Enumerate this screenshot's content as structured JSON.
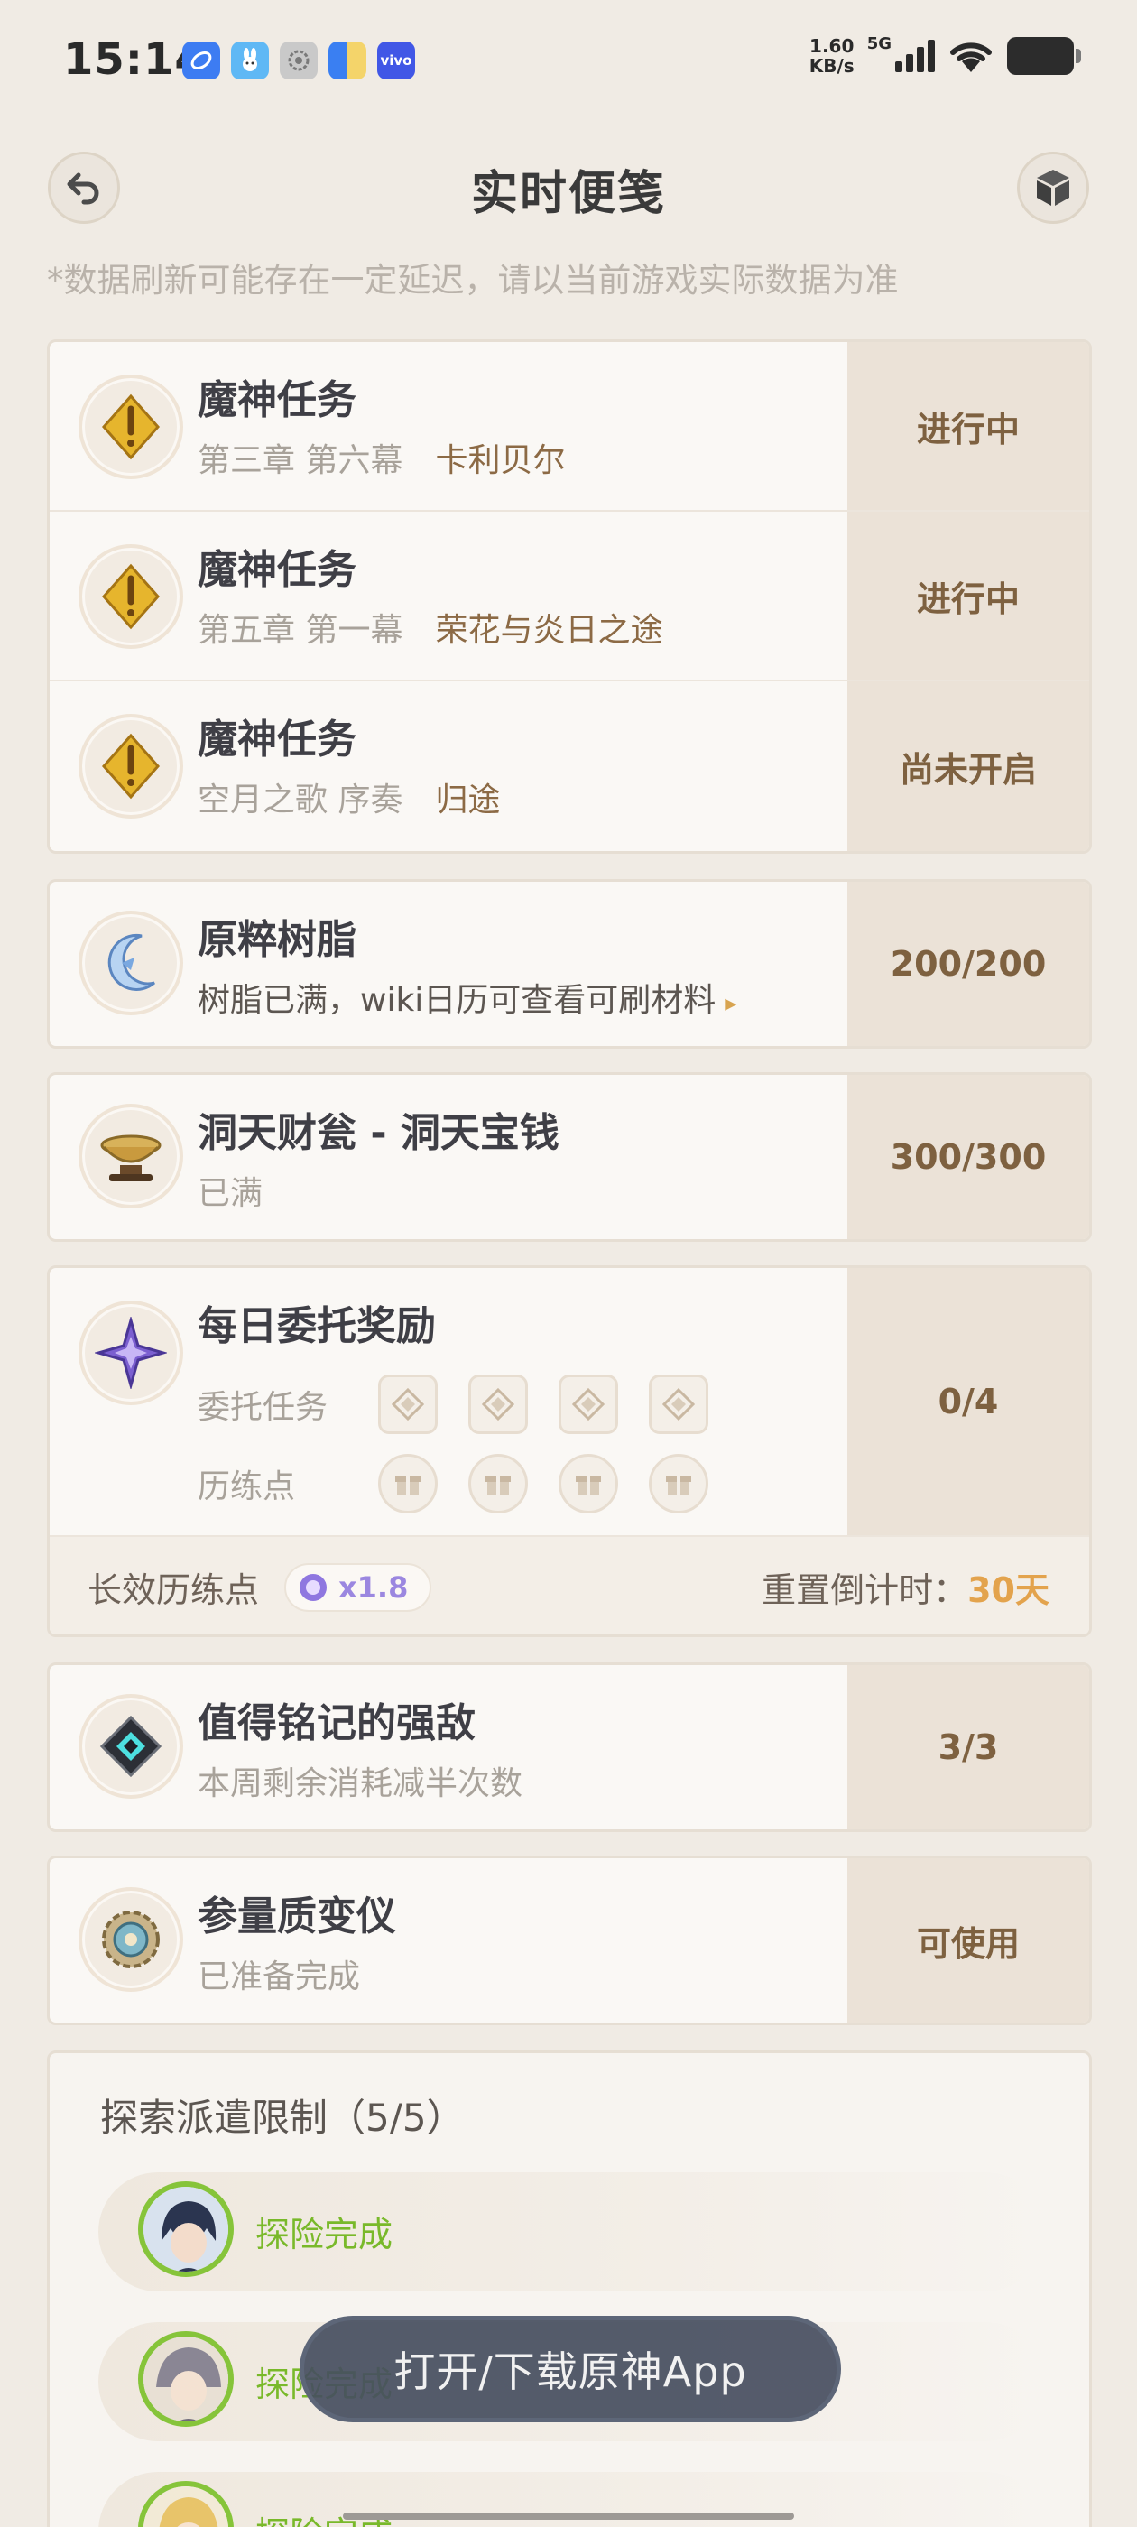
{
  "status_bar": {
    "time": "15:14",
    "net_speed_value": "1.60",
    "net_speed_unit": "KB/s",
    "network": "5G",
    "app_icons": [
      "browser-icon",
      "bunny-app-icon",
      "settings-icon",
      "finder-icon",
      "vivo-icon"
    ],
    "vivo_label": "vivo"
  },
  "header": {
    "title": "实时便笺",
    "notice": "*数据刷新可能存在一定延迟，请以当前游戏实际数据为准"
  },
  "quests": [
    {
      "title": "魔神任务",
      "chapter": "第三章 第六幕",
      "name": "卡利贝尔",
      "status": "进行中"
    },
    {
      "title": "魔神任务",
      "chapter": "第五章 第一幕",
      "name": "荣花与炎日之途",
      "status": "进行中"
    },
    {
      "title": "魔神任务",
      "chapter": "空月之歌 序奏",
      "name": "归途",
      "status": "尚未开启"
    }
  ],
  "resin": {
    "title": "原粹树脂",
    "subtitle": "树脂已满，wiki日历可查看可刷材料",
    "arrow": "▸",
    "value": "200/200"
  },
  "realm": {
    "title": "洞天财瓮 - 洞天宝钱",
    "subtitle": "已满",
    "value": "300/300"
  },
  "commission": {
    "title": "每日委托奖励",
    "tasks_label": "委托任务",
    "points_label": "历练点",
    "tasks_done": 0,
    "tasks_total": 4,
    "value": "0/4",
    "long_points_label": "长效历练点",
    "multiplier": "x1.8",
    "reset_label": "重置倒计时：",
    "reset_days": "30天"
  },
  "boss": {
    "title": "值得铭记的强敌",
    "subtitle": "本周剩余消耗减半次数",
    "value": "3/3"
  },
  "transformer": {
    "title": "参量质变仪",
    "subtitle": "已准备完成",
    "value": "可使用"
  },
  "expedition": {
    "title": "探索派遣限制（5/5）",
    "items": [
      {
        "status": "探险完成"
      },
      {
        "status": "探险完成"
      },
      {
        "status": "探险完成"
      }
    ]
  },
  "fab": {
    "label": "打开/下载原神App"
  },
  "colors": {
    "background": "#f0ebe4",
    "side_panel": "#ebe2d7",
    "status_text": "#7e6140",
    "accent_orange": "#e3a34d",
    "complete_green": "#79b92a",
    "purple": "#9b87e0"
  }
}
